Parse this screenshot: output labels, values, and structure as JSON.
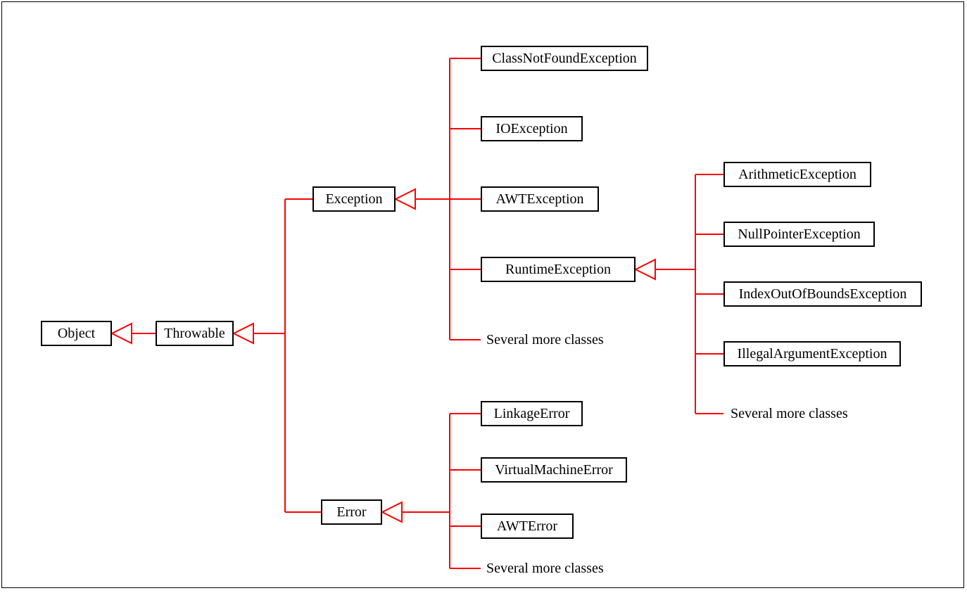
{
  "colors": {
    "line": "#ff0000",
    "box_border": "#000000",
    "text": "#000000"
  },
  "more_label": "Several more classes",
  "nodes": {
    "object": "Object",
    "throwable": "Throwable",
    "exception": "Exception",
    "error": "Error",
    "classNotFound": "ClassNotFoundException",
    "ioException": "IOException",
    "awtException": "AWTException",
    "runtimeException": "RuntimeException",
    "linkageError": "LinkageError",
    "virtualMachineError": "VirtualMachineError",
    "awtError": "AWTError",
    "arithmetic": "ArithmeticException",
    "nullPointer": "NullPointerException",
    "indexOOB": "IndexOutOfBoundsException",
    "illegalArg": "IllegalArgumentException"
  },
  "hierarchy": {
    "root": "Object",
    "children": [
      {
        "name": "Throwable",
        "children": [
          {
            "name": "Exception",
            "children": [
              {
                "name": "ClassNotFoundException"
              },
              {
                "name": "IOException"
              },
              {
                "name": "AWTException"
              },
              {
                "name": "RuntimeException",
                "children": [
                  {
                    "name": "ArithmeticException"
                  },
                  {
                    "name": "NullPointerException"
                  },
                  {
                    "name": "IndexOutOfBoundsException"
                  },
                  {
                    "name": "IllegalArgumentException"
                  },
                  {
                    "name": "Several more classes",
                    "plain": true
                  }
                ]
              },
              {
                "name": "Several more classes",
                "plain": true
              }
            ]
          },
          {
            "name": "Error",
            "children": [
              {
                "name": "LinkageError"
              },
              {
                "name": "VirtualMachineError"
              },
              {
                "name": "AWTError"
              },
              {
                "name": "Several more classes",
                "plain": true
              }
            ]
          }
        ]
      }
    ]
  }
}
